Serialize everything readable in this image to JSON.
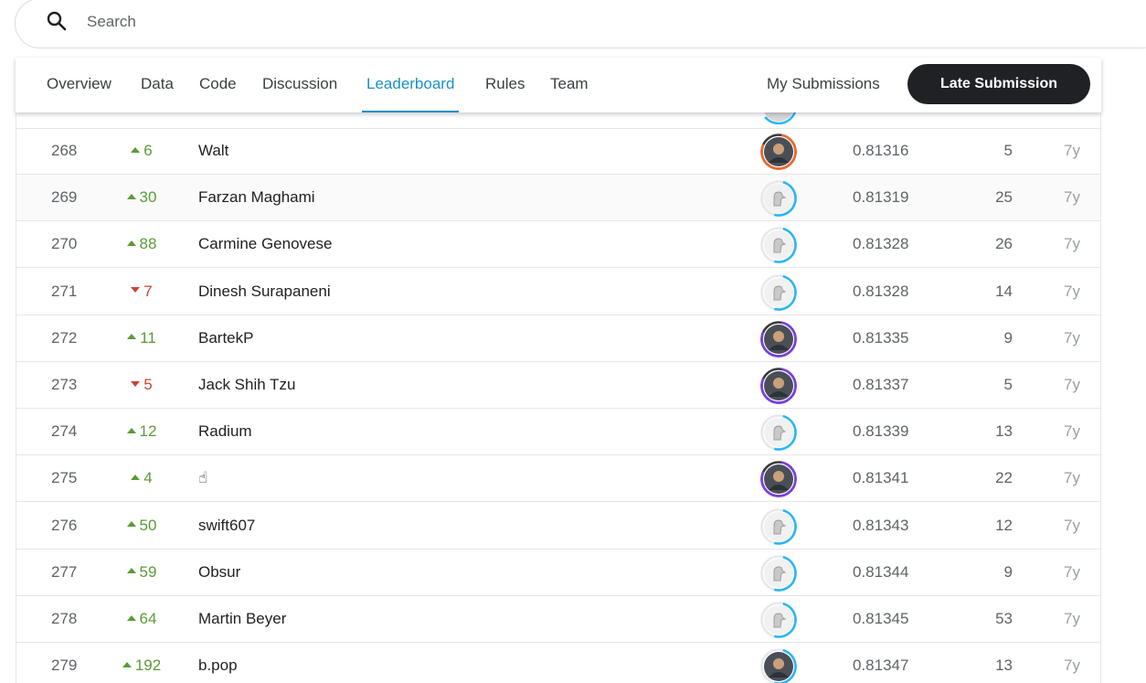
{
  "search": {
    "placeholder": "Search",
    "icon": "search-icon"
  },
  "tabs": [
    {
      "label": "Overview",
      "active": false
    },
    {
      "label": "Data",
      "active": false
    },
    {
      "label": "Code",
      "active": false
    },
    {
      "label": "Discussion",
      "active": false
    },
    {
      "label": "Leaderboard",
      "active": true
    },
    {
      "label": "Rules",
      "active": false
    },
    {
      "label": "Team",
      "active": false
    }
  ],
  "header_actions": {
    "my_submissions": "My Submissions",
    "late_submission": "Late Submission"
  },
  "colors": {
    "accent": "#1d8fc8",
    "up": "#5a9b35",
    "down": "#c5443a",
    "button": "#202124"
  },
  "leaderboard": {
    "rows": [
      {
        "rank": "268",
        "direction": "up",
        "delta": "6",
        "team": "Walt",
        "avatar": "photo-avatar",
        "tier": "orange",
        "score": "0.81316",
        "entries": "5",
        "last": "7y"
      },
      {
        "rank": "269",
        "direction": "up",
        "delta": "30",
        "team": "Farzan Maghami",
        "avatar": "default-avatar",
        "tier": "blue",
        "score": "0.81319",
        "entries": "25",
        "last": "7y"
      },
      {
        "rank": "270",
        "direction": "up",
        "delta": "88",
        "team": "Carmine Genovese",
        "avatar": "default-avatar",
        "tier": "blue",
        "score": "0.81328",
        "entries": "26",
        "last": "7y"
      },
      {
        "rank": "271",
        "direction": "down",
        "delta": "7",
        "team": "Dinesh Surapaneni",
        "avatar": "default-avatar",
        "tier": "blue",
        "score": "0.81328",
        "entries": "14",
        "last": "7y"
      },
      {
        "rank": "272",
        "direction": "up",
        "delta": "11",
        "team": "BartekP",
        "avatar": "photo-avatar",
        "tier": "purple",
        "score": "0.81335",
        "entries": "9",
        "last": "7y"
      },
      {
        "rank": "273",
        "direction": "down",
        "delta": "5",
        "team": "Jack Shih Tzu",
        "avatar": "photo-avatar",
        "tier": "purple",
        "score": "0.81337",
        "entries": "5",
        "last": "7y"
      },
      {
        "rank": "274",
        "direction": "up",
        "delta": "12",
        "team": "Radium",
        "avatar": "default-avatar",
        "tier": "blue",
        "score": "0.81339",
        "entries": "13",
        "last": "7y"
      },
      {
        "rank": "275",
        "direction": "up",
        "delta": "4",
        "team": "☝",
        "avatar": "photo-avatar",
        "tier": "purple",
        "score": "0.81341",
        "entries": "22",
        "last": "7y"
      },
      {
        "rank": "276",
        "direction": "up",
        "delta": "50",
        "team": "swift607",
        "avatar": "default-avatar",
        "tier": "blue",
        "score": "0.81343",
        "entries": "12",
        "last": "7y"
      },
      {
        "rank": "277",
        "direction": "up",
        "delta": "59",
        "team": "Obsur",
        "avatar": "default-avatar",
        "tier": "blue",
        "score": "0.81344",
        "entries": "9",
        "last": "7y"
      },
      {
        "rank": "278",
        "direction": "up",
        "delta": "64",
        "team": "Martin Beyer",
        "avatar": "default-avatar",
        "tier": "blue",
        "score": "0.81345",
        "entries": "53",
        "last": "7y"
      },
      {
        "rank": "279",
        "direction": "up",
        "delta": "192",
        "team": "b.pop",
        "avatar": "photo-avatar",
        "tier": "blue",
        "score": "0.81347",
        "entries": "13",
        "last": "7y"
      }
    ]
  }
}
